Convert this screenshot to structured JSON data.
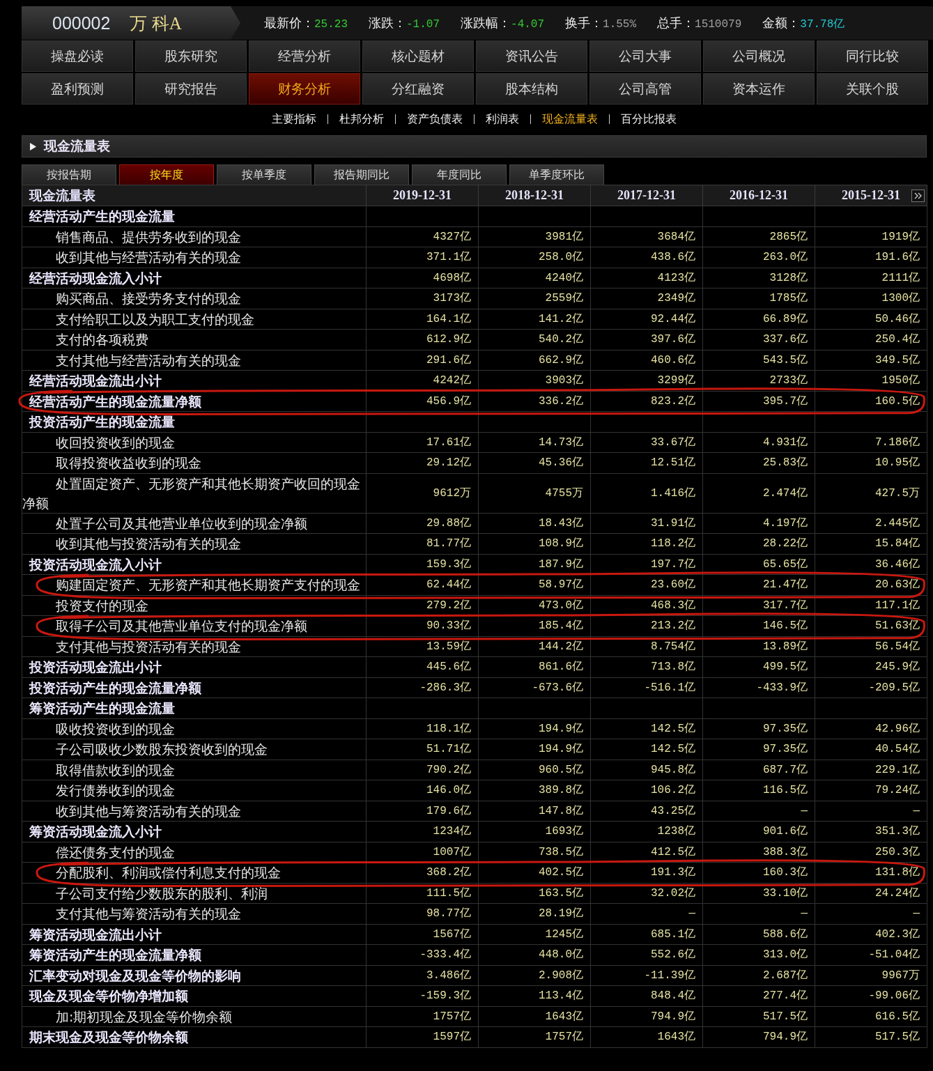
{
  "quote": {
    "code": "000002",
    "name": "万 科A",
    "stats": [
      {
        "label": "最新价：",
        "value": "25.23",
        "color": "#33cc33"
      },
      {
        "label": "涨跌：",
        "value": "-1.07",
        "color": "#33cc33"
      },
      {
        "label": "涨跌幅：",
        "value": "-4.07",
        "color": "#33cc33"
      },
      {
        "label": "换手：",
        "value": "1.55%",
        "color": "#a0a0a0"
      },
      {
        "label": "总手：",
        "value": "1510079",
        "color": "#a0a0a0"
      },
      {
        "label": "金额：",
        "value": "37.78亿",
        "color": "#22c8d0"
      }
    ]
  },
  "nav_tabs": [
    {
      "label": "操盘必读",
      "selected": false
    },
    {
      "label": "股东研究",
      "selected": false
    },
    {
      "label": "经营分析",
      "selected": false
    },
    {
      "label": "核心题材",
      "selected": false
    },
    {
      "label": "资讯公告",
      "selected": false
    },
    {
      "label": "公司大事",
      "selected": false
    },
    {
      "label": "公司概况",
      "selected": false
    },
    {
      "label": "同行比较",
      "selected": false
    },
    {
      "label": "盈利预测",
      "selected": false
    },
    {
      "label": "研究报告",
      "selected": false
    },
    {
      "label": "财务分析",
      "selected": true
    },
    {
      "label": "分红融资",
      "selected": false
    },
    {
      "label": "股本结构",
      "selected": false
    },
    {
      "label": "公司高管",
      "selected": false
    },
    {
      "label": "资本运作",
      "selected": false
    },
    {
      "label": "关联个股",
      "selected": false
    }
  ],
  "report_links": [
    {
      "label": "主要指标",
      "selected": false
    },
    {
      "label": "杜邦分析",
      "selected": false
    },
    {
      "label": "资产负债表",
      "selected": false
    },
    {
      "label": "利润表",
      "selected": false
    },
    {
      "label": "现金流量表",
      "selected": true
    },
    {
      "label": "百分比报表",
      "selected": false
    }
  ],
  "section": {
    "title": "现金流量表"
  },
  "period_tabs": [
    {
      "label": "按报告期",
      "selected": false
    },
    {
      "label": "按年度",
      "selected": true
    },
    {
      "label": "按单季度",
      "selected": false
    },
    {
      "label": "报告期同比",
      "selected": false
    },
    {
      "label": "年度同比",
      "selected": false
    },
    {
      "label": "单季度环比",
      "selected": false
    }
  ],
  "table": {
    "columns": [
      "现金流量表",
      "2019-12-31",
      "2018-12-31",
      "2017-12-31",
      "2016-12-31",
      "2015-12-31"
    ],
    "rows": [
      {
        "kind": "heading",
        "label": "经营活动产生的现金流量",
        "circled": false
      },
      {
        "kind": "item",
        "label": "销售商品、提供劳务收到的现金",
        "values": [
          "4327亿",
          "3981亿",
          "3684亿",
          "2865亿",
          "1919亿"
        ],
        "circled": false
      },
      {
        "kind": "item",
        "label": "收到其他与经营活动有关的现金",
        "values": [
          "371.1亿",
          "258.0亿",
          "438.6亿",
          "263.0亿",
          "191.6亿"
        ],
        "circled": false
      },
      {
        "kind": "heading",
        "label": "经营活动现金流入小计",
        "values": [
          "4698亿",
          "4240亿",
          "4123亿",
          "3128亿",
          "2111亿"
        ],
        "circled": false
      },
      {
        "kind": "item",
        "label": "购买商品、接受劳务支付的现金",
        "values": [
          "3173亿",
          "2559亿",
          "2349亿",
          "1785亿",
          "1300亿"
        ],
        "circled": false
      },
      {
        "kind": "item",
        "label": "支付给职工以及为职工支付的现金",
        "values": [
          "164.1亿",
          "141.2亿",
          "92.44亿",
          "66.89亿",
          "50.46亿"
        ],
        "circled": false
      },
      {
        "kind": "item",
        "label": "支付的各项税费",
        "values": [
          "612.9亿",
          "540.2亿",
          "397.6亿",
          "337.6亿",
          "250.4亿"
        ],
        "circled": false
      },
      {
        "kind": "item",
        "label": "支付其他与经营活动有关的现金",
        "values": [
          "291.6亿",
          "662.9亿",
          "460.6亿",
          "543.5亿",
          "349.5亿"
        ],
        "circled": false
      },
      {
        "kind": "heading",
        "label": "经营活动现金流出小计",
        "values": [
          "4242亿",
          "3903亿",
          "3299亿",
          "2733亿",
          "1950亿"
        ],
        "circled": false
      },
      {
        "kind": "heading",
        "label": "经营活动产生的现金流量净额",
        "values": [
          "456.9亿",
          "336.2亿",
          "823.2亿",
          "395.7亿",
          "160.5亿"
        ],
        "circled": true
      },
      {
        "kind": "heading",
        "label": "投资活动产生的现金流量",
        "circled": false
      },
      {
        "kind": "item",
        "label": "收回投资收到的现金",
        "values": [
          "17.61亿",
          "14.73亿",
          "33.67亿",
          "4.931亿",
          "7.186亿"
        ],
        "circled": false
      },
      {
        "kind": "item",
        "label": "取得投资收益收到的现金",
        "values": [
          "29.12亿",
          "45.36亿",
          "12.51亿",
          "25.83亿",
          "10.95亿"
        ],
        "circled": false
      },
      {
        "kind": "item",
        "label": "处置固定资产、无形资产和其他长期资产收回的现金净额",
        "values": [
          "9612万",
          "4755万",
          "1.416亿",
          "2.474亿",
          "427.5万"
        ],
        "circled": false
      },
      {
        "kind": "item",
        "label": "处置子公司及其他营业单位收到的现金净额",
        "values": [
          "29.88亿",
          "18.43亿",
          "31.91亿",
          "4.197亿",
          "2.445亿"
        ],
        "circled": false
      },
      {
        "kind": "item",
        "label": "收到其他与投资活动有关的现金",
        "values": [
          "81.77亿",
          "108.9亿",
          "118.2亿",
          "28.22亿",
          "15.84亿"
        ],
        "circled": false
      },
      {
        "kind": "heading",
        "label": "投资活动现金流入小计",
        "values": [
          "159.3亿",
          "187.9亿",
          "197.7亿",
          "65.65亿",
          "36.46亿"
        ],
        "circled": false
      },
      {
        "kind": "item",
        "label": "购建固定资产、无形资产和其他长期资产支付的现金",
        "values": [
          "62.44亿",
          "58.97亿",
          "23.60亿",
          "21.47亿",
          "20.63亿"
        ],
        "circled": true
      },
      {
        "kind": "item",
        "label": "投资支付的现金",
        "values": [
          "279.2亿",
          "473.0亿",
          "468.3亿",
          "317.7亿",
          "117.1亿"
        ],
        "circled": false
      },
      {
        "kind": "item",
        "label": "取得子公司及其他营业单位支付的现金净额",
        "values": [
          "90.33亿",
          "185.4亿",
          "213.2亿",
          "146.5亿",
          "51.63亿"
        ],
        "circled": true
      },
      {
        "kind": "item",
        "label": "支付其他与投资活动有关的现金",
        "values": [
          "13.59亿",
          "144.2亿",
          "8.754亿",
          "13.89亿",
          "56.54亿"
        ],
        "circled": false
      },
      {
        "kind": "heading",
        "label": "投资活动现金流出小计",
        "values": [
          "445.6亿",
          "861.6亿",
          "713.8亿",
          "499.5亿",
          "245.9亿"
        ],
        "circled": false
      },
      {
        "kind": "heading",
        "label": "投资活动产生的现金流量净额",
        "values": [
          "-286.3亿",
          "-673.6亿",
          "-516.1亿",
          "-433.9亿",
          "-209.5亿"
        ],
        "circled": false
      },
      {
        "kind": "heading",
        "label": "筹资活动产生的现金流量",
        "circled": false
      },
      {
        "kind": "item",
        "label": "吸收投资收到的现金",
        "values": [
          "118.1亿",
          "194.9亿",
          "142.5亿",
          "97.35亿",
          "42.96亿"
        ],
        "circled": false
      },
      {
        "kind": "item",
        "label": "子公司吸收少数股东投资收到的现金",
        "values": [
          "51.71亿",
          "194.9亿",
          "142.5亿",
          "97.35亿",
          "40.54亿"
        ],
        "circled": false
      },
      {
        "kind": "item",
        "label": "取得借款收到的现金",
        "values": [
          "790.2亿",
          "960.5亿",
          "945.8亿",
          "687.7亿",
          "229.1亿"
        ],
        "circled": false
      },
      {
        "kind": "item",
        "label": "发行债券收到的现金",
        "values": [
          "146.0亿",
          "389.8亿",
          "106.2亿",
          "116.5亿",
          "79.24亿"
        ],
        "circled": false
      },
      {
        "kind": "item",
        "label": "收到其他与筹资活动有关的现金",
        "values": [
          "179.6亿",
          "147.8亿",
          "43.25亿",
          "—",
          "—"
        ],
        "circled": false
      },
      {
        "kind": "heading",
        "label": "筹资活动现金流入小计",
        "values": [
          "1234亿",
          "1693亿",
          "1238亿",
          "901.6亿",
          "351.3亿"
        ],
        "circled": false
      },
      {
        "kind": "item",
        "label": "偿还债务支付的现金",
        "values": [
          "1007亿",
          "738.5亿",
          "412.5亿",
          "388.3亿",
          "250.3亿"
        ],
        "circled": false
      },
      {
        "kind": "item",
        "label": "分配股利、利润或偿付利息支付的现金",
        "values": [
          "368.2亿",
          "402.5亿",
          "191.3亿",
          "160.3亿",
          "131.8亿"
        ],
        "circled": true
      },
      {
        "kind": "item",
        "label": "子公司支付给少数股东的股利、利润",
        "values": [
          "111.5亿",
          "163.5亿",
          "32.02亿",
          "33.10亿",
          "24.24亿"
        ],
        "circled": false
      },
      {
        "kind": "item",
        "label": "支付其他与筹资活动有关的现金",
        "values": [
          "98.77亿",
          "28.19亿",
          "—",
          "—",
          "—"
        ],
        "circled": false
      },
      {
        "kind": "heading",
        "label": "筹资活动现金流出小计",
        "values": [
          "1567亿",
          "1245亿",
          "685.1亿",
          "588.6亿",
          "402.3亿"
        ],
        "circled": false
      },
      {
        "kind": "heading",
        "label": "筹资活动产生的现金流量净额",
        "values": [
          "-333.4亿",
          "448.0亿",
          "552.6亿",
          "313.0亿",
          "-51.04亿"
        ],
        "circled": false
      },
      {
        "kind": "heading",
        "label": "汇率变动对现金及现金等价物的影响",
        "values": [
          "3.486亿",
          "2.908亿",
          "-11.39亿",
          "2.687亿",
          "9967万"
        ],
        "circled": false
      },
      {
        "kind": "heading",
        "label": "现金及现金等价物净增加额",
        "values": [
          "-159.3亿",
          "113.4亿",
          "848.4亿",
          "277.4亿",
          "-99.06亿"
        ],
        "circled": false
      },
      {
        "kind": "item",
        "label": "加:期初现金及现金等价物余额",
        "values": [
          "1757亿",
          "1643亿",
          "794.9亿",
          "517.5亿",
          "616.5亿"
        ],
        "circled": false
      },
      {
        "kind": "heading",
        "label": "期末现金及现金等价物余额",
        "values": [
          "1597亿",
          "1757亿",
          "1643亿",
          "794.9亿",
          "517.5亿"
        ],
        "circled": false
      }
    ]
  }
}
